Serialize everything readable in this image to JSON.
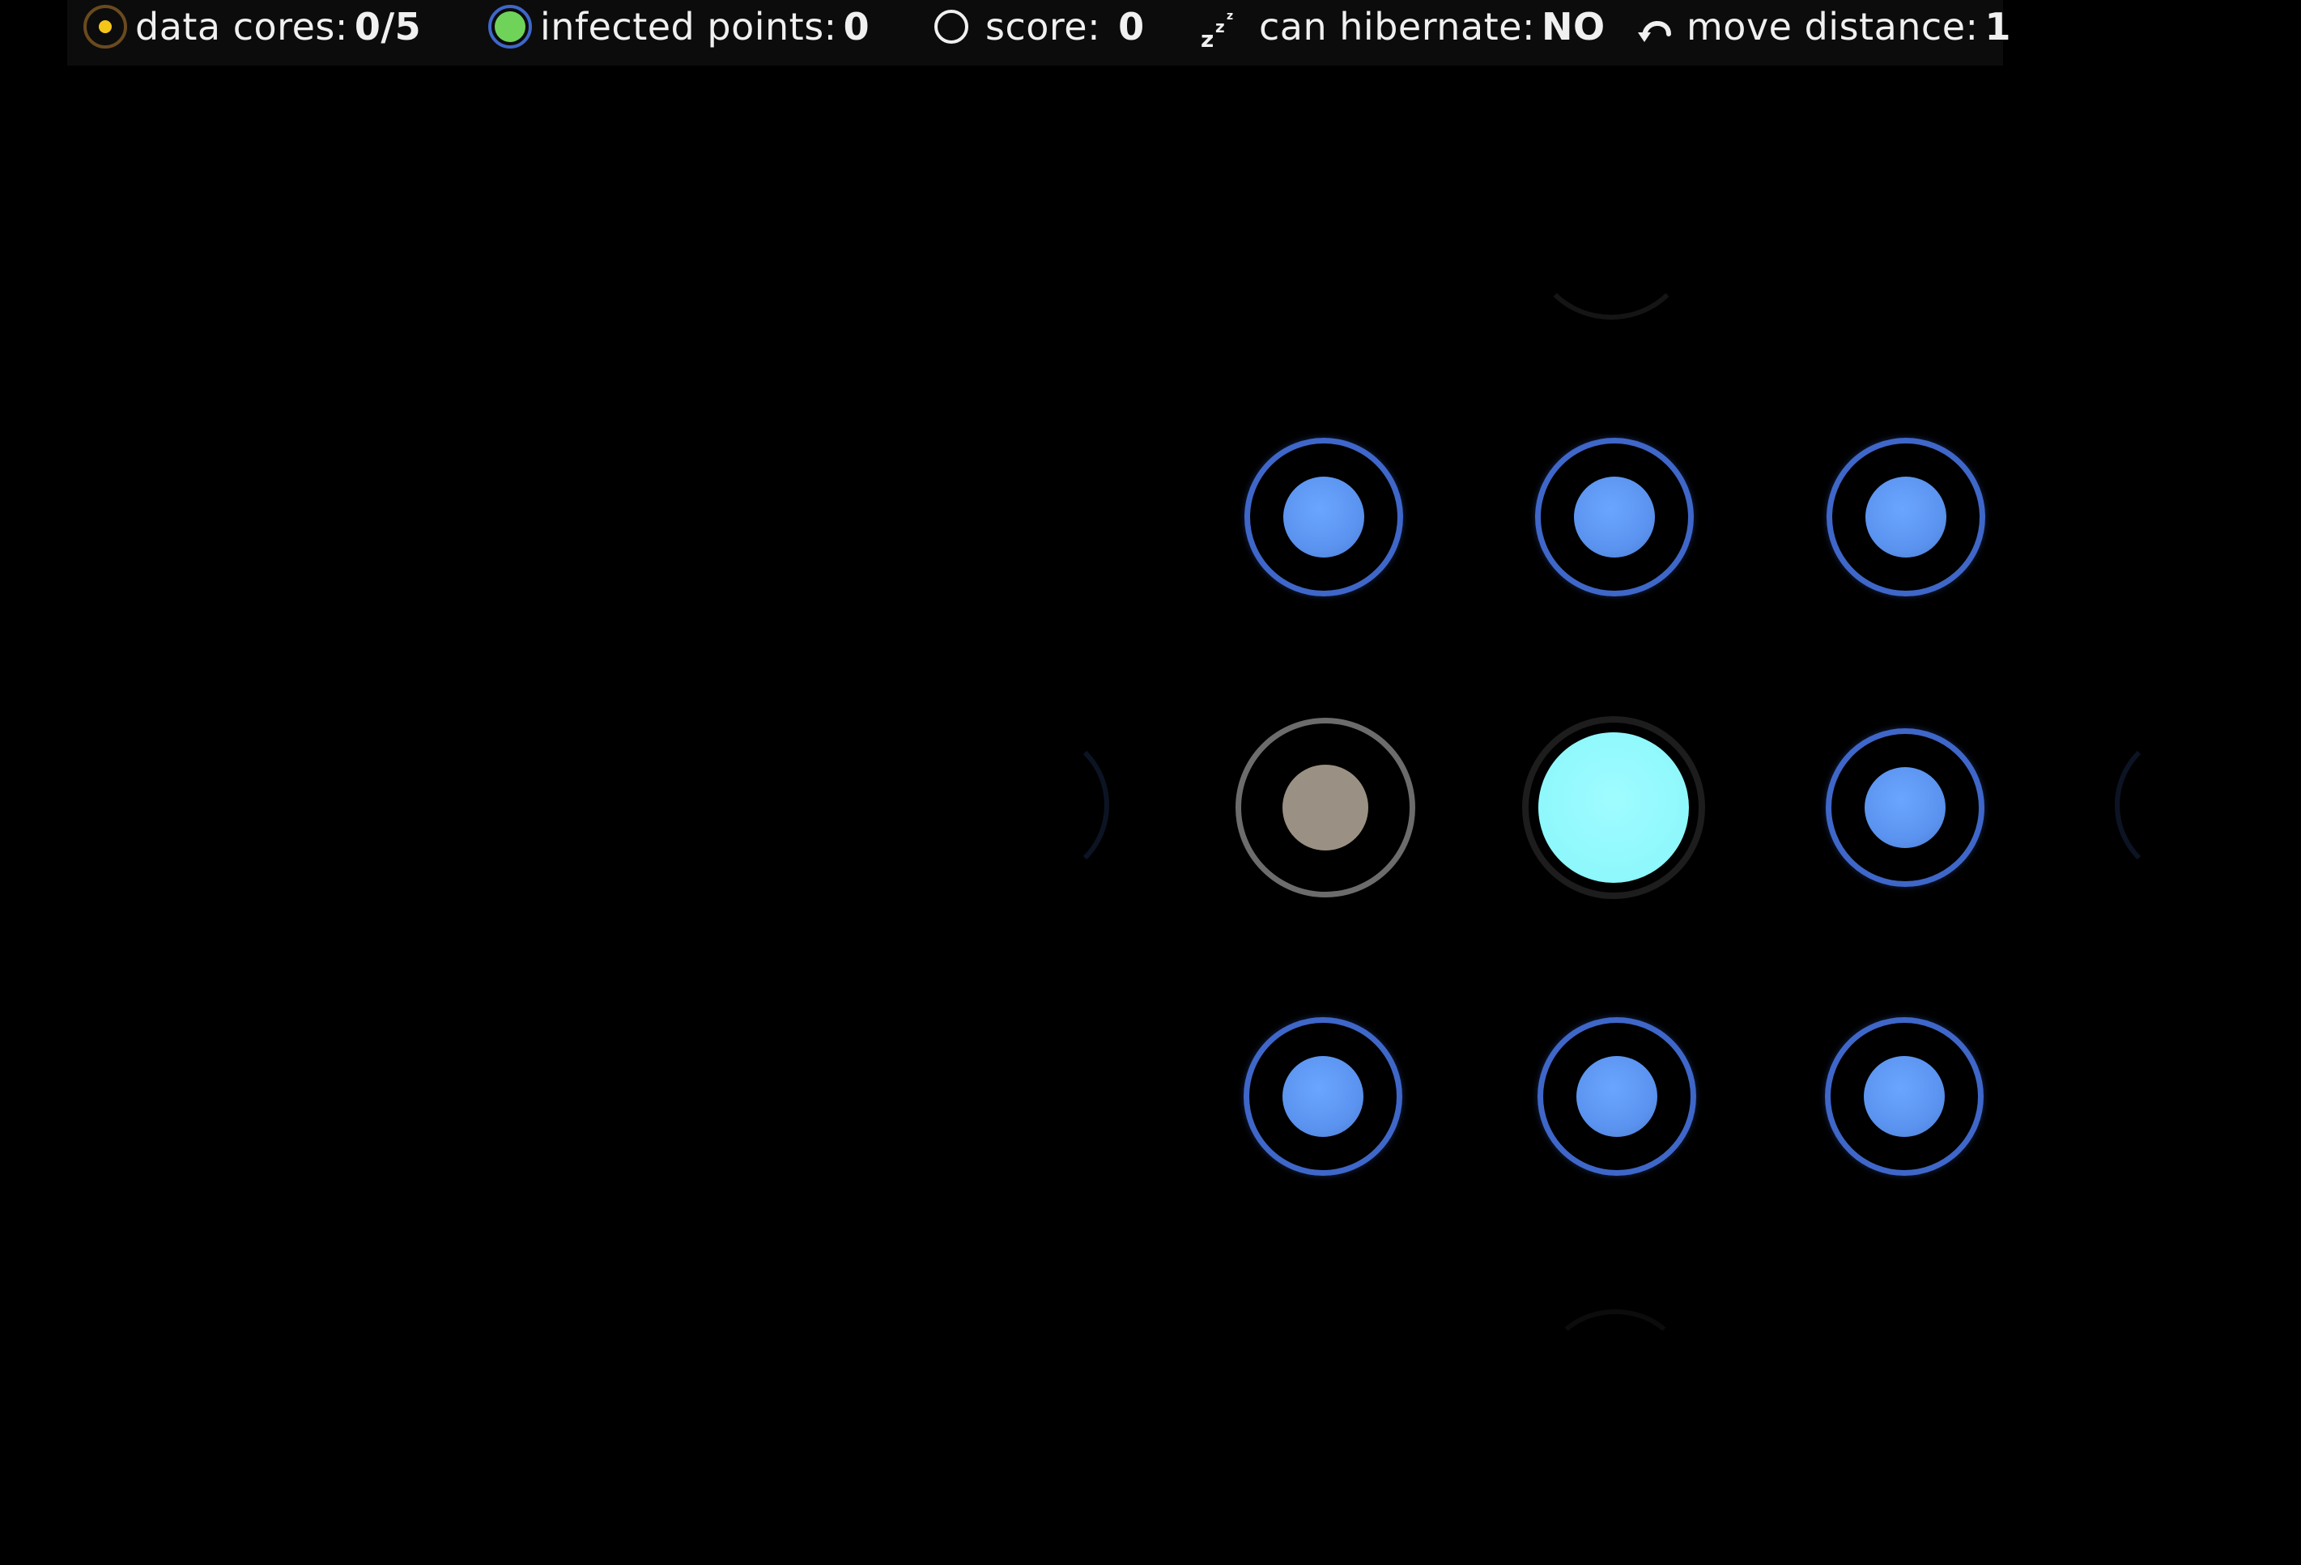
{
  "hud": {
    "data_cores": {
      "label": "data cores:",
      "value": "0/5",
      "icon": "data-core-icon"
    },
    "infected_points": {
      "label": "infected points:",
      "value": "0",
      "icon": "infected-point-icon"
    },
    "score": {
      "label": "score:",
      "value": "0",
      "icon": "score-ring-icon"
    },
    "hibernate": {
      "label": "can hibernate:",
      "value": "NO",
      "icon": "sleep-zzz-icon"
    },
    "move_distance": {
      "label": "move distance:",
      "value": "1",
      "icon": "curved-arrow-icon"
    }
  },
  "colors": {
    "hud_background": "#0c0c0c",
    "node_ring_blue": "#3f67c9",
    "node_core_blue": "#5b94f0",
    "node_ring_grey": "#6c6c6c",
    "node_core_grey": "#9a9184",
    "player_core": "#8ef8fc",
    "data_core_yellow": "#f5c518",
    "infected_green": "#6fd35a"
  },
  "board": {
    "nodes": [
      {
        "id": "node-r1-c1",
        "state": "available"
      },
      {
        "id": "node-r1-c2",
        "state": "available"
      },
      {
        "id": "node-r1-c3",
        "state": "available"
      },
      {
        "id": "node-r2-c1",
        "state": "visited"
      },
      {
        "id": "node-r2-c2",
        "state": "player"
      },
      {
        "id": "node-r2-c3",
        "state": "available"
      },
      {
        "id": "node-r3-c1",
        "state": "available"
      },
      {
        "id": "node-r3-c2",
        "state": "available"
      },
      {
        "id": "node-r3-c3",
        "state": "available"
      }
    ]
  }
}
